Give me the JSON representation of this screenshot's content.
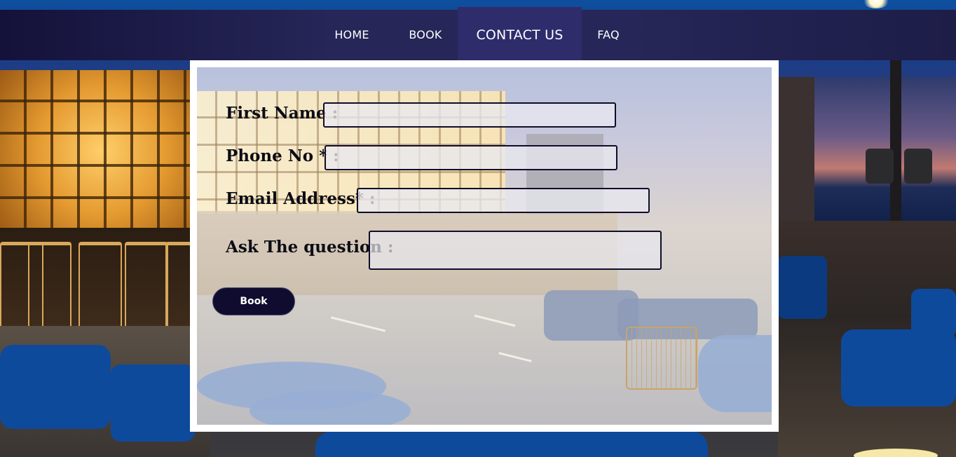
{
  "nav": {
    "items": [
      {
        "label": "HOME",
        "active": false
      },
      {
        "label": "BOOK",
        "active": false
      },
      {
        "label": "CONTACT US",
        "active": true
      },
      {
        "label": "FAQ",
        "active": false
      }
    ]
  },
  "form": {
    "first_name_label": "First Name :",
    "phone_label": "Phone No * :",
    "email_label": "Email Address* :",
    "question_label": "Ask The question :",
    "first_name_value": "",
    "phone_value": "",
    "email_value": "",
    "question_value": "",
    "submit_label": "Book"
  },
  "colors": {
    "nav_background": "#262658",
    "nav_active": "#2f2c6c",
    "button_background": "#0f0c30",
    "input_border": "#0f0d2a"
  }
}
